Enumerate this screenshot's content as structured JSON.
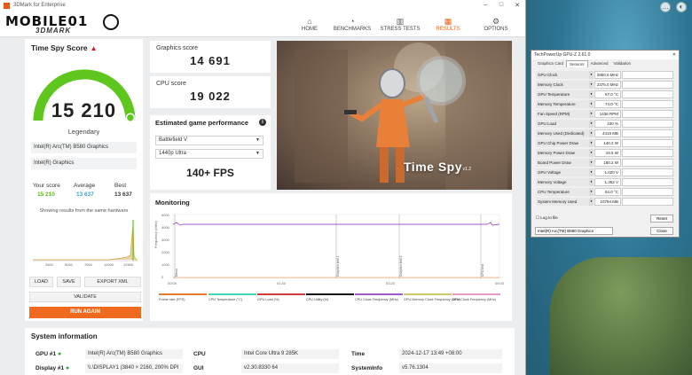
{
  "window": {
    "title": "3DMark for Enterprise"
  },
  "brand": {
    "watermark": "MOBILE01",
    "logo": "3DMARK"
  },
  "nav": [
    {
      "label": "HOME",
      "icon": "home-icon",
      "glyph": "⌂"
    },
    {
      "label": "BENCHMARKS",
      "icon": "gauge-icon",
      "glyph": "◔"
    },
    {
      "label": "STRESS TESTS",
      "icon": "bars-icon",
      "glyph": "▥"
    },
    {
      "label": "RESULTS",
      "icon": "results-icon",
      "glyph": "▦",
      "active": true
    },
    {
      "label": "OPTIONS",
      "icon": "gear-icon",
      "glyph": "⚙"
    }
  ],
  "score": {
    "title": "Time Spy Score",
    "value": "15 210",
    "rank": "Legendary",
    "gauge_fraction": 0.98,
    "gpu": "Intel(R) Arc(TM) B580 Graphics",
    "igpu": "Intel(R) Graphics",
    "your_score_label": "Your score",
    "your_score": "15 210",
    "average_label": "Average",
    "average": "13 637",
    "best_label": "Best",
    "best": "13 637",
    "hist_label": "Showing results from the same hardware",
    "hist_ticks": [
      "2500",
      "5000",
      "7500",
      "10000",
      "12500"
    ],
    "load": "LOAD",
    "save": "SAVE",
    "export": "EXPORT XML",
    "validate": "VALIDATE",
    "run_again": "RUN AGAIN",
    "accent": "#ef6a1f",
    "gauge_color": "#5fc61e"
  },
  "graphics": {
    "label": "Graphics score",
    "value": "14 691"
  },
  "cpu": {
    "label": "CPU score",
    "value": "19 022"
  },
  "estimate": {
    "title": "Estimated game performance",
    "game": "Battlefield V",
    "preset": "1440p Ultra",
    "fps": "140+ FPS"
  },
  "hero": {
    "title": "Time Spy",
    "version": "v1.2"
  },
  "monitoring": {
    "title": "Monitoring",
    "y_label": "Frequency (MHz)",
    "y_ticks": [
      "5000",
      "4000",
      "3000",
      "2000",
      "1000",
      "0"
    ],
    "x_ticks": [
      "00:00",
      "01:40",
      "03:20",
      "05:00"
    ],
    "markers": [
      "Demo",
      "Graphics test 1",
      "Graphics test 2",
      "CPU test"
    ],
    "legend": [
      {
        "label": "Frame rate (FPS)",
        "color": "#e8772e"
      },
      {
        "label": "CPU Temperature (°C)",
        "color": "#3fd6c0"
      },
      {
        "label": "GPU Load (%)",
        "color": "#d13b3b"
      },
      {
        "label": "CPU Utility (%)",
        "color": "#111111"
      },
      {
        "label": "CPU Clock Frequency (MHz)",
        "color": "#a35acb"
      },
      {
        "label": "GPU Memory Clock Frequency (MHz)",
        "color": "#cfc86a"
      },
      {
        "label": "GPU Clock Frequency (MHz)",
        "color": "#e79ac9"
      }
    ]
  },
  "sysinfo": {
    "title": "System information",
    "gpu_label": "GPU #1",
    "gpu_value": "Intel(R) Arc(TM) B580 Graphics",
    "display_label": "Display #1",
    "display_value": "\\\\.\\DISPLAY1 (3840 × 2160, 200% DPI",
    "cpu_label": "CPU",
    "cpu_value": "Intel Core Ultra 9 285K",
    "gui_label": "GUI",
    "gui_value": "v2.30.8330 64",
    "time_label": "Time",
    "time_value": "2024-12-17 13:49 +08:00",
    "sysinfo_label": "SystemInfo",
    "sysinfo_value": "v5.76.1304"
  },
  "gpuz": {
    "title": "TechPowerUp GPU-Z 2.61.0",
    "tabs": [
      "Graphics Card",
      "Sensors",
      "Advanced",
      "Validation"
    ],
    "sensors": [
      {
        "name": "GPU Clock",
        "value": "2850.0 MHz",
        "level": 0.85
      },
      {
        "name": "Memory Clock",
        "value": "2375.0 MHz",
        "level": 0.85
      },
      {
        "name": "GPU Temperature",
        "value": "67.0 °C",
        "level": 0.6
      },
      {
        "name": "Memory Temperature",
        "value": "74.0 °C",
        "level": 0.65
      },
      {
        "name": "Fan Speed (RPM)",
        "value": "1436 RPM",
        "level": 0.55
      },
      {
        "name": "GPU Load",
        "value": "100 %",
        "level": 0.95
      },
      {
        "name": "Memory Used (Dedicated)",
        "value": "4419 MB",
        "level": 0.45
      },
      {
        "name": "GPU Chip Power Draw",
        "value": "140.2 W",
        "level": 0.75
      },
      {
        "name": "Memory Power Draw",
        "value": "19.5 W",
        "level": 0.5
      },
      {
        "name": "Board Power Draw",
        "value": "180.2 W",
        "level": 0.8
      },
      {
        "name": "GPU Voltage",
        "value": "1.020 V",
        "level": 0.7
      },
      {
        "name": "Memory Voltage",
        "value": "1.352 V",
        "level": 0.9
      },
      {
        "name": "CPU Temperature",
        "value": "64.0 °C",
        "level": 0.55
      },
      {
        "name": "System Memory Used",
        "value": "10794 MB",
        "level": 0.6
      }
    ],
    "log_label": "Log to file",
    "reset": "Reset",
    "device": "Intel(R) Arc(TM) B580 Graphics",
    "close": "Close"
  }
}
